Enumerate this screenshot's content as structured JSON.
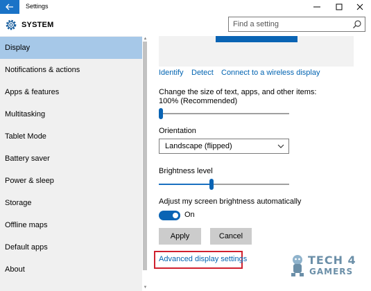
{
  "window": {
    "title": "Settings"
  },
  "header": {
    "section": "SYSTEM",
    "search_placeholder": "Find a setting"
  },
  "sidebar": {
    "items": [
      {
        "label": "Display",
        "active": true
      },
      {
        "label": "Notifications & actions"
      },
      {
        "label": "Apps & features"
      },
      {
        "label": "Multitasking"
      },
      {
        "label": "Tablet Mode"
      },
      {
        "label": "Battery saver"
      },
      {
        "label": "Power & sleep"
      },
      {
        "label": "Storage"
      },
      {
        "label": "Offline maps"
      },
      {
        "label": "Default apps"
      },
      {
        "label": "About"
      }
    ]
  },
  "main": {
    "links": {
      "identify": "Identify",
      "detect": "Detect",
      "connect": "Connect to a wireless display"
    },
    "scale_label": "Change the size of text, apps, and other items: 100% (Recommended)",
    "scale_level": 0,
    "orientation_label": "Orientation",
    "orientation_value": "Landscape (flipped)",
    "brightness_label": "Brightness level",
    "brightness_level": 0.4,
    "auto_brightness_label": "Adjust my screen brightness automatically",
    "auto_brightness_state": "On",
    "apply_label": "Apply",
    "cancel_label": "Cancel",
    "advanced_link": "Advanced display settings"
  },
  "watermark": {
    "line1": "TECH 4",
    "line2": "GAMERS"
  },
  "colors": {
    "accent": "#0a64b4",
    "link": "#0063b1",
    "highlight": "#d0202e",
    "active_nav": "#a6c8e8"
  }
}
